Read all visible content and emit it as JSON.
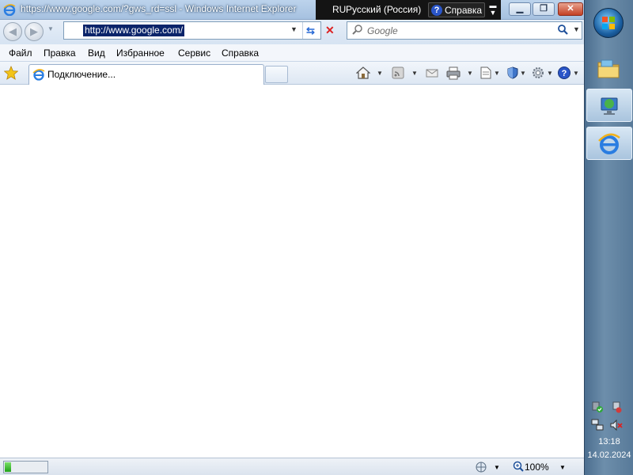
{
  "window": {
    "title": "https://www.google.com/?gws_rd=ssl - Windows Internet Explorer"
  },
  "language_bar": {
    "code": "RU",
    "language": "Русский (Россия)",
    "help_label": "Справка"
  },
  "address_bar": {
    "url": "http://www.google.com/"
  },
  "search": {
    "placeholder": "Google"
  },
  "menu": {
    "items": [
      "Файл",
      "Правка",
      "Вид",
      "Избранное",
      "Сервис",
      "Справка"
    ]
  },
  "tabs": {
    "active_label": "Подключение..."
  },
  "status_bar": {
    "zoom": "100%",
    "progress": 0.15
  },
  "taskbar": {
    "time": "13:18",
    "date": "14.02.2024"
  },
  "colors": {
    "selection": "#0a246a",
    "accent": "#2a6bd6",
    "progress": "#1fa117"
  }
}
